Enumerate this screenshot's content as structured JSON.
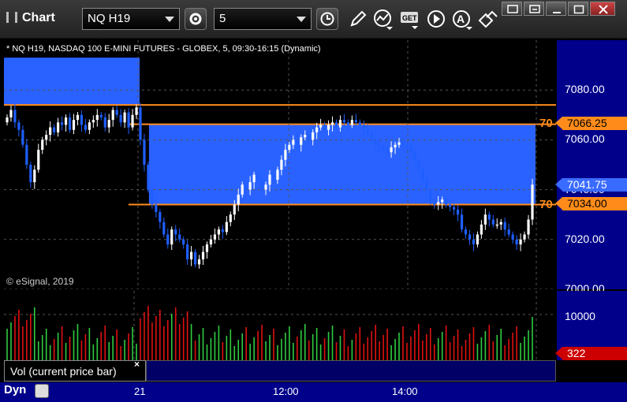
{
  "window": {
    "title": "Chart"
  },
  "toolbar": {
    "symbol": "NQ H19",
    "interval": "5",
    "icons": [
      "clock-icon",
      "pencil-icon",
      "studies-icon",
      "get-icon",
      "play-icon",
      "alert-icon",
      "link-icon",
      "gear-icon"
    ]
  },
  "chart": {
    "symbol_description": "* NQ H19, NASDAQ 100 E-MINI FUTURES - GLOBEX, 5, 09:30-16:15 (Dynamic)",
    "copyright": "© eSignal, 2019",
    "price_axis": [
      "7080.00",
      "7060.00",
      "7040.00",
      "7020.00",
      "7000.00"
    ],
    "price_range": [
      7000,
      7100
    ],
    "upper_level": {
      "label": "70",
      "price": "7066.25"
    },
    "lower_level": {
      "label": "70",
      "price": "7034.00"
    },
    "current_price": "7041.75",
    "time_axis": [
      "21",
      "12:00",
      "14:00"
    ],
    "colors": {
      "up": "#ffffff",
      "down": "#1f5fff",
      "zone": "#2a62ff",
      "level": "#ff8c1a",
      "axis_bg": "#00008b"
    }
  },
  "volume": {
    "legend": "Vol (current price bar)",
    "axis_label": "10000",
    "current": "322",
    "colors": {
      "up": "#2ecc40",
      "down": "#e01010"
    }
  },
  "status": {
    "mode": "Dyn"
  },
  "chart_data": {
    "type": "candlestick",
    "title": "NQ H19, NASDAQ 100 E-MINI FUTURES - GLOBEX, 5, 09:30-16:15 (Dynamic)",
    "ylim": [
      7000,
      7100
    ],
    "yticks": [
      7080,
      7060,
      7040,
      7020,
      7000
    ],
    "xticks": [
      "21",
      "12:00",
      "14:00"
    ],
    "zones": [
      {
        "top": 7093,
        "bottom": 7074,
        "bar_start": 0,
        "bar_end": 33
      },
      {
        "top": 7066.25,
        "bottom": 7034,
        "bar_start": 37,
        "bar_end": 134
      }
    ],
    "current_price": 7041.75,
    "close": [
      7069,
      7072,
      7067,
      7064,
      7058,
      7050,
      7043,
      7048,
      7056,
      7060,
      7062,
      7065,
      7063,
      7067,
      7066,
      7069,
      7064,
      7068,
      7070,
      7066,
      7064,
      7067,
      7068,
      7070,
      7069,
      7065,
      7068,
      7072,
      7070,
      7067,
      7071,
      7065,
      7070,
      7073,
      7060,
      7050,
      7040,
      7034,
      7031,
      7027,
      7022,
      7018,
      7024,
      7022,
      7020,
      7018,
      7012,
      7015,
      7010,
      7012,
      7015,
      7018,
      7020,
      7022,
      7024,
      7023,
      7027,
      7030,
      7034,
      7038,
      7042,
      7040,
      7043,
      7046,
      7044,
      7040,
      7042,
      7046,
      7044,
      7048,
      7052,
      7056,
      7058,
      7060,
      7058,
      7061,
      7062,
      7060,
      7063,
      7065,
      7066,
      7064,
      7066,
      7067,
      7065,
      7068,
      7067,
      7066,
      7068,
      7067,
      7066,
      7064,
      7062,
      7060,
      7058,
      7057,
      7056,
      7055,
      7057,
      7058,
      7059,
      7058,
      7057,
      7055,
      7052,
      7048,
      7044,
      7040,
      7035,
      7034,
      7035,
      7036,
      7034,
      7033,
      7032,
      7030,
      7024,
      7022,
      7020,
      7018,
      7022,
      7026,
      7030,
      7028,
      7026,
      7026,
      7027,
      7024,
      7022,
      7020,
      7018,
      7020,
      7022,
      7028,
      7042
    ]
  }
}
